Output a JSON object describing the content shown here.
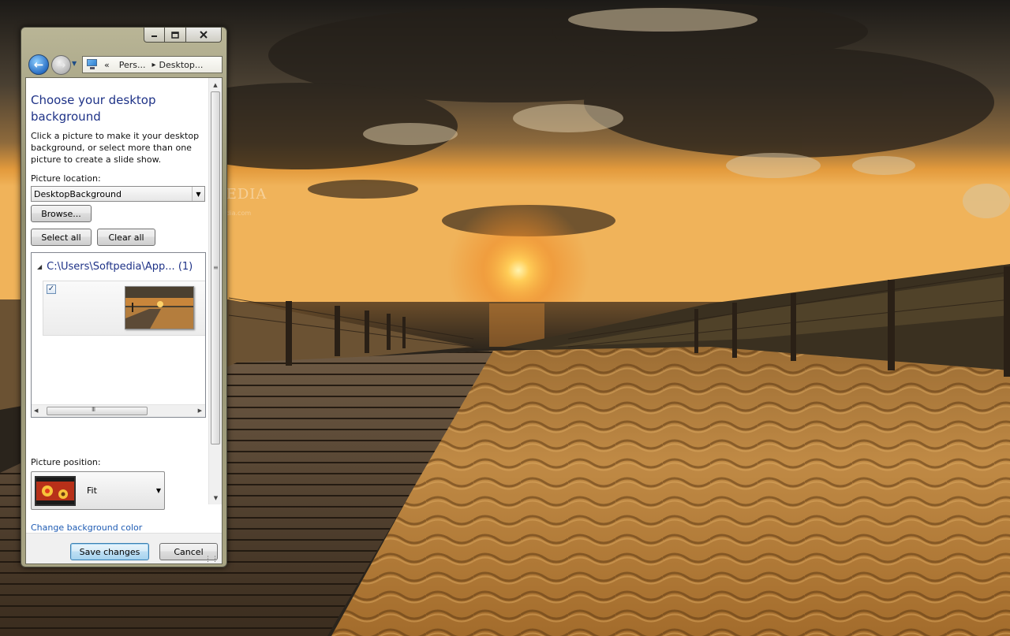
{
  "window": {
    "caption_buttons": {
      "minimize": "minimize-icon",
      "maximize": "maximize-icon",
      "close": "close-icon"
    },
    "address": {
      "ellipsis": "«",
      "crumbs": [
        "Pers...",
        "Desktop..."
      ]
    }
  },
  "page": {
    "title": "Choose your desktop background",
    "description": "Click a picture to make it your desktop background, or select more than one picture to create a slide show.",
    "location_label": "Picture location:",
    "location_value": "DesktopBackground",
    "browse_label": "Browse...",
    "select_all_label": "Select all",
    "clear_all_label": "Clear all",
    "gallery": {
      "group_title": "C:\\Users\\Softpedia\\App... (1)",
      "items": [
        {
          "checked": true,
          "checkmark": "✓"
        }
      ],
      "hscroll_grip": "III"
    },
    "position_label": "Picture position:",
    "position_value": "Fit",
    "background_color_link": "Change background color"
  },
  "footer": {
    "save_label": "Save changes",
    "cancel_label": "Cancel"
  },
  "desktop": {
    "watermark": "SOFTPEDIA",
    "watermark_sub": "www.softpedia.com"
  }
}
